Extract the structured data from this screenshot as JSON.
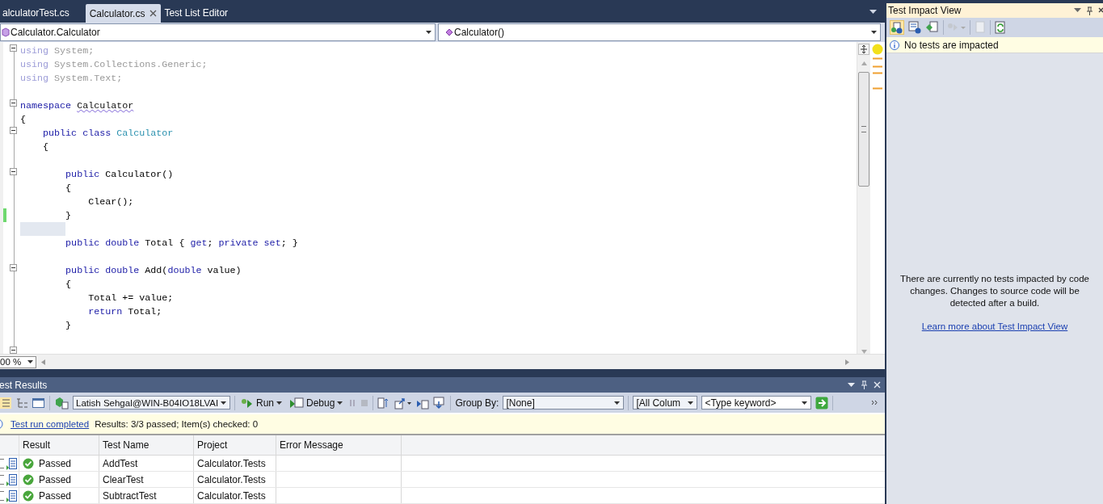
{
  "tabs": [
    {
      "label": "alculatorTest.cs",
      "selected": false
    },
    {
      "label": "Calculator.cs",
      "selected": true
    },
    {
      "label": "Test List Editor",
      "selected": false
    }
  ],
  "nav": {
    "type_combo": "Calculator.Calculator",
    "member_combo": "Calculator()"
  },
  "code_lines": [
    {
      "fold": true,
      "changed": false,
      "tokens": [
        {
          "kind": "dimkw",
          "text": "using"
        },
        {
          "kind": "dim",
          "text": " System;"
        }
      ]
    },
    {
      "fold": false,
      "changed": false,
      "tokens": [
        {
          "kind": "dimkw",
          "text": "using"
        },
        {
          "kind": "dim",
          "text": " System.Collections.Generic;"
        }
      ]
    },
    {
      "fold": false,
      "changed": false,
      "tokens": [
        {
          "kind": "dimkw",
          "text": "using"
        },
        {
          "kind": "dim",
          "text": " System.Text;"
        }
      ]
    },
    {
      "fold": false,
      "changed": false
    },
    {
      "fold": true,
      "changed": false,
      "tokens": [
        {
          "kind": "kw",
          "text": "namespace "
        },
        {
          "kind": "squiggle",
          "text": "Calculator"
        }
      ]
    },
    {
      "fold": false,
      "changed": false,
      "tokens": [
        {
          "kind": "plain",
          "text": "{"
        }
      ]
    },
    {
      "fold": true,
      "changed": false,
      "tokens": [
        {
          "kind": "kw",
          "text": "    public class "
        },
        {
          "kind": "type",
          "text": "Calculator"
        }
      ]
    },
    {
      "fold": false,
      "changed": false,
      "tokens": [
        {
          "kind": "plain",
          "text": "    {"
        }
      ]
    },
    {
      "fold": false,
      "changed": false
    },
    {
      "fold": true,
      "changed": false,
      "tokens": [
        {
          "kind": "kw",
          "text": "        public"
        },
        {
          "kind": "plain",
          "text": " Calculator()"
        }
      ]
    },
    {
      "fold": false,
      "changed": false,
      "tokens": [
        {
          "kind": "plain",
          "text": "        {"
        }
      ]
    },
    {
      "fold": false,
      "changed": false,
      "tokens": [
        {
          "kind": "plain",
          "text": "            Clear();"
        }
      ]
    },
    {
      "fold": false,
      "changed": true,
      "tokens": [
        {
          "kind": "plain",
          "text": "        }"
        }
      ]
    },
    {
      "fold": false,
      "changed": false
    },
    {
      "fold": false,
      "changed": false,
      "tokens": [
        {
          "kind": "kw",
          "text": "        public double"
        },
        {
          "kind": "plain",
          "text": " Total { "
        },
        {
          "kind": "kw",
          "text": "get"
        },
        {
          "kind": "plain",
          "text": "; "
        },
        {
          "kind": "kw",
          "text": "private set"
        },
        {
          "kind": "plain",
          "text": "; }"
        }
      ]
    },
    {
      "fold": false,
      "changed": false
    },
    {
      "fold": true,
      "changed": false,
      "tokens": [
        {
          "kind": "kw",
          "text": "        public double"
        },
        {
          "kind": "plain",
          "text": " Add("
        },
        {
          "kind": "kw",
          "text": "double"
        },
        {
          "kind": "plain",
          "text": " value)"
        }
      ]
    },
    {
      "fold": false,
      "changed": false,
      "tokens": [
        {
          "kind": "plain",
          "text": "        {"
        }
      ]
    },
    {
      "fold": false,
      "changed": false,
      "tokens": [
        {
          "kind": "plain",
          "text": "            Total += value;"
        }
      ]
    },
    {
      "fold": false,
      "changed": false,
      "tokens": [
        {
          "kind": "kw",
          "text": "            return"
        },
        {
          "kind": "plain",
          "text": " Total;"
        }
      ]
    },
    {
      "fold": false,
      "changed": false,
      "tokens": [
        {
          "kind": "plain",
          "text": "        }"
        }
      ]
    },
    {
      "fold": false,
      "changed": false
    },
    {
      "fold": true,
      "changed": false
    }
  ],
  "zoom": "00 %",
  "results": {
    "title": "est Results",
    "run_config": "Latish Sehgal@WIN-B04IO18LVAI",
    "run": "Run",
    "debug": "Debug",
    "group_by_label": "Group By:",
    "group_by": "[None]",
    "columns_filter": "[All Colum",
    "keyword": "<Type keyword>",
    "status_link": "Test run completed",
    "summary": "Results: 3/3 passed;  Item(s) checked: 0",
    "columns": [
      "Result",
      "Test Name",
      "Project",
      "Error Message"
    ],
    "rows": [
      {
        "checked": false,
        "kind": "passed",
        "result": "Passed",
        "test_name": "AddTest",
        "project": "Calculator.Tests"
      },
      {
        "checked": false,
        "kind": "passed",
        "result": "Passed",
        "test_name": "ClearTest",
        "project": "Calculator.Tests"
      },
      {
        "checked": false,
        "kind": "passed",
        "result": "Passed",
        "test_name": "SubtractTest",
        "project": "Calculator.Tests"
      }
    ]
  },
  "impact": {
    "title": "Test Impact View",
    "info": "No tests are impacted",
    "message": "There are currently no tests impacted by code changes.  Changes to source code will be detected after a build.",
    "link": "Learn more about Test Impact View"
  }
}
